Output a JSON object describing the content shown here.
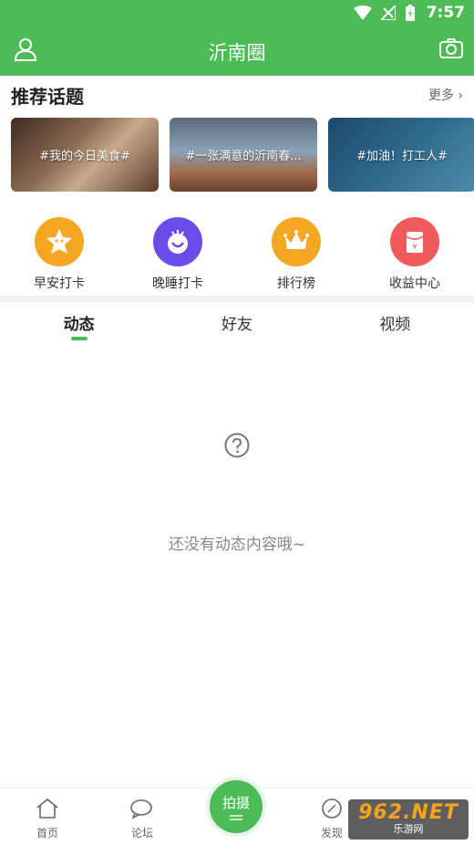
{
  "status_bar": {
    "time": "7:57"
  },
  "nav": {
    "title": "沂南圈"
  },
  "topics": {
    "title": "推荐话题",
    "more": "更多",
    "cards": [
      {
        "label": "#我的今日美食#"
      },
      {
        "label": "#一张满意的沂南春..."
      },
      {
        "label": "#加油！打工人#"
      }
    ]
  },
  "quick_actions": [
    {
      "label": "早安打卡",
      "icon": "star-face-icon",
      "color": "#F5A623"
    },
    {
      "label": "晚睡打卡",
      "icon": "moon-face-icon",
      "color": "#6C4CE8"
    },
    {
      "label": "排行榜",
      "icon": "crown-icon",
      "color": "#F5A623"
    },
    {
      "label": "收益中心",
      "icon": "red-envelope-icon",
      "color": "#EF5B5B"
    }
  ],
  "tabs": [
    {
      "label": "动态",
      "active": true
    },
    {
      "label": "好友",
      "active": false
    },
    {
      "label": "视频",
      "active": false
    }
  ],
  "empty_state": {
    "text": "还没有动态内容哦~"
  },
  "bottom_nav": {
    "home": "首页",
    "forum": "论坛",
    "shoot": "拍摄",
    "discover": "发现"
  },
  "watermark": {
    "big": "962.NET",
    "small": "乐游网"
  },
  "colors": {
    "brand_green": "#4CBC56"
  }
}
